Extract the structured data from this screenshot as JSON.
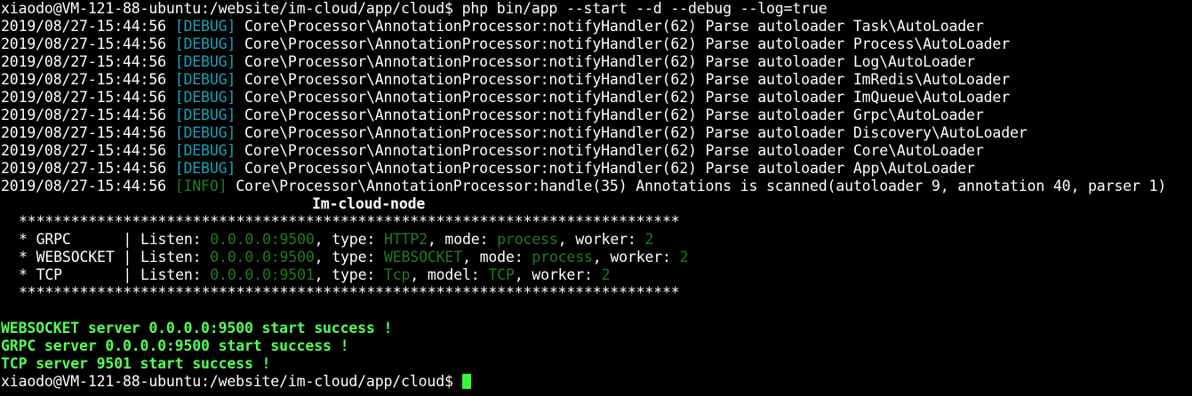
{
  "terminal": {
    "prompt_user_host": "xiaodo@VM-121-88-ubuntu:/website/im-cloud/app/cloud$",
    "command": "php bin/app --start --d --debug --log=true",
    "colors": {
      "debug": "#17a2b8",
      "info": "#1e7c1e",
      "success": "#55ff55",
      "cursor": "#33ff33"
    },
    "log_lines": [
      {
        "ts": "2019/08/27-15:44:56",
        "level": "[DEBUG]",
        "msg": "Core\\Processor\\AnnotationProcessor:notifyHandler(62) Parse autoloader Task\\AutoLoader"
      },
      {
        "ts": "2019/08/27-15:44:56",
        "level": "[DEBUG]",
        "msg": "Core\\Processor\\AnnotationProcessor:notifyHandler(62) Parse autoloader Process\\AutoLoader"
      },
      {
        "ts": "2019/08/27-15:44:56",
        "level": "[DEBUG]",
        "msg": "Core\\Processor\\AnnotationProcessor:notifyHandler(62) Parse autoloader Log\\AutoLoader"
      },
      {
        "ts": "2019/08/27-15:44:56",
        "level": "[DEBUG]",
        "msg": "Core\\Processor\\AnnotationProcessor:notifyHandler(62) Parse autoloader ImRedis\\AutoLoader"
      },
      {
        "ts": "2019/08/27-15:44:56",
        "level": "[DEBUG]",
        "msg": "Core\\Processor\\AnnotationProcessor:notifyHandler(62) Parse autoloader ImQueue\\AutoLoader"
      },
      {
        "ts": "2019/08/27-15:44:56",
        "level": "[DEBUG]",
        "msg": "Core\\Processor\\AnnotationProcessor:notifyHandler(62) Parse autoloader Grpc\\AutoLoader"
      },
      {
        "ts": "2019/08/27-15:44:56",
        "level": "[DEBUG]",
        "msg": "Core\\Processor\\AnnotationProcessor:notifyHandler(62) Parse autoloader Discovery\\AutoLoader"
      },
      {
        "ts": "2019/08/27-15:44:56",
        "level": "[DEBUG]",
        "msg": "Core\\Processor\\AnnotationProcessor:notifyHandler(62) Parse autoloader Core\\AutoLoader"
      },
      {
        "ts": "2019/08/27-15:44:56",
        "level": "[DEBUG]",
        "msg": "Core\\Processor\\AnnotationProcessor:notifyHandler(62) Parse autoloader App\\AutoLoader"
      },
      {
        "ts": "2019/08/27-15:44:56",
        "level": "[INFO]",
        "msg": "Core\\Processor\\AnnotationProcessor:handle(35) Annotations is scanned(autoloader 9, annotation 40, parser 1)"
      }
    ],
    "banner_title": "Im-cloud-node",
    "banner_border": "****************************************************************************",
    "servers": [
      {
        "prefix": "* GRPC      | Listen: ",
        "listen": "0.0.0.0:9500",
        "type_label": ", type: ",
        "type": "HTTP2",
        "mode_label": ", mode: ",
        "mode": "process",
        "worker_label": ", worker: ",
        "worker": "2"
      },
      {
        "prefix": "* WEBSOCKET | Listen: ",
        "listen": "0.0.0.0:9500",
        "type_label": ", type: ",
        "type": "WEBSOCKET",
        "mode_label": ", mode: ",
        "mode": "process",
        "worker_label": ", worker: ",
        "worker": "2"
      },
      {
        "prefix": "* TCP       | Listen: ",
        "listen": "0.0.0.0:9501",
        "type_label": ", type: ",
        "type": "Tcp",
        "mode_label": ", model: ",
        "mode": "TCP",
        "worker_label": ", worker: ",
        "worker": "2"
      }
    ],
    "success_lines": [
      "WEBSOCKET server 0.0.0.0:9500 start success !",
      "GRPC server 0.0.0.0:9500 start success !",
      "TCP server 9501 start success !"
    ]
  }
}
